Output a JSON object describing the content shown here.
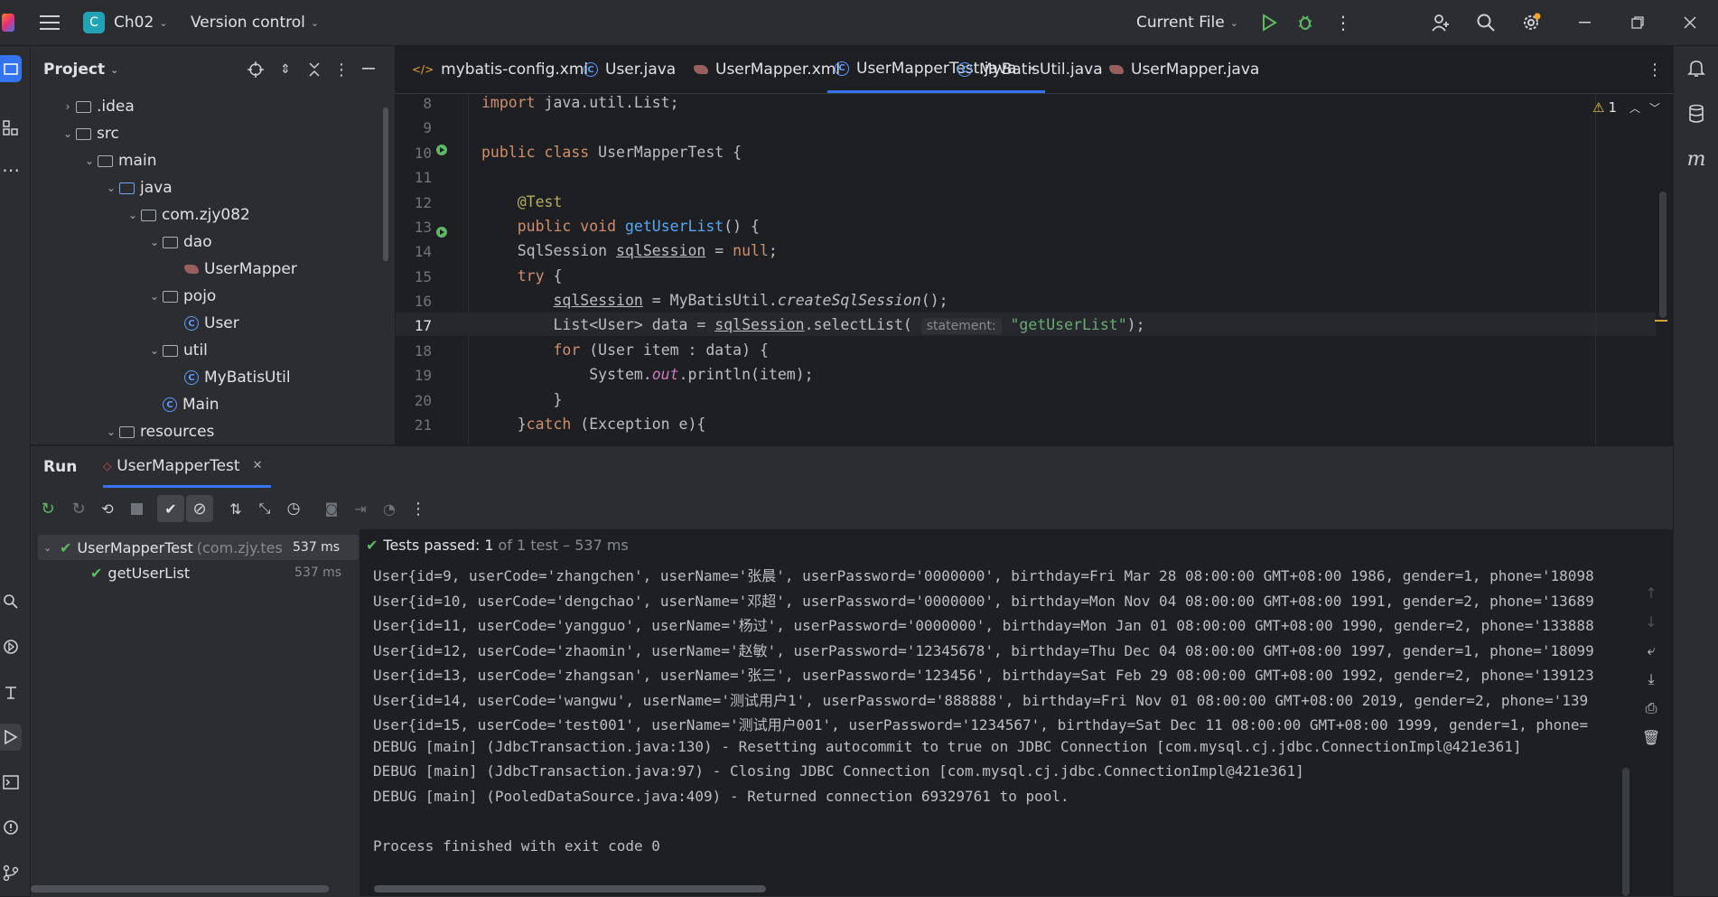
{
  "titlebar": {
    "project_badge": "C",
    "project_name": "Ch02",
    "version_control": "Version control",
    "run_config": "Current File"
  },
  "project_panel": {
    "title": "Project",
    "tree": [
      {
        "label": ".idea",
        "indent": 0,
        "toggle": "›",
        "kind": "folder"
      },
      {
        "label": "src",
        "indent": 0,
        "toggle": "⌄",
        "kind": "folder"
      },
      {
        "label": "main",
        "indent": 1,
        "toggle": "⌄",
        "kind": "folder"
      },
      {
        "label": "java",
        "indent": 2,
        "toggle": "⌄",
        "kind": "folder-blue"
      },
      {
        "label": "com.zjy082",
        "indent": 3,
        "toggle": "⌄",
        "kind": "package"
      },
      {
        "label": "dao",
        "indent": 4,
        "toggle": "⌄",
        "kind": "package"
      },
      {
        "label": "UserMapper",
        "indent": 5,
        "toggle": "",
        "kind": "mybatis"
      },
      {
        "label": "pojo",
        "indent": 4,
        "toggle": "⌄",
        "kind": "package"
      },
      {
        "label": "User",
        "indent": 5,
        "toggle": "",
        "kind": "class"
      },
      {
        "label": "util",
        "indent": 4,
        "toggle": "⌄",
        "kind": "package"
      },
      {
        "label": "MyBatisUtil",
        "indent": 5,
        "toggle": "",
        "kind": "class"
      },
      {
        "label": "Main",
        "indent": 4,
        "toggle": "",
        "kind": "class"
      },
      {
        "label": "resources",
        "indent": 2,
        "toggle": "⌄",
        "kind": "folder"
      }
    ]
  },
  "tabs": [
    {
      "label": "mybatis-config.xml",
      "icon": "xml-icon"
    },
    {
      "label": "User.java",
      "icon": "class-icon"
    },
    {
      "label": "UserMapper.xml",
      "icon": "mybatis-icon"
    },
    {
      "label": "UserMapperTest.java",
      "icon": "class-icon",
      "active": true
    },
    {
      "label": "MyBatisUtil.java",
      "icon": "class-icon"
    },
    {
      "label": "UserMapper.java",
      "icon": "mybatis-icon"
    }
  ],
  "editor": {
    "warning_count": "1",
    "line_numbers": [
      "8",
      "9",
      "10",
      "11",
      "12",
      "13",
      "14",
      "15",
      "16",
      "17",
      "18",
      "19",
      "20",
      "21"
    ],
    "param_hint": "statement:"
  },
  "run": {
    "title": "Run",
    "config_tab": "UserMapperTest",
    "status_prefix": "Tests passed:",
    "status_count": "1",
    "status_rest": "of 1 test – 537 ms",
    "tree_root": {
      "name": "UserMapperTest",
      "pkg": "(com.zjy.tes",
      "time": "537 ms"
    },
    "tree_child": {
      "name": "getUserList",
      "time": "537 ms"
    },
    "console": [
      "User{id=9, userCode='zhangchen', userName='张晨', userPassword='0000000', birthday=Fri Mar 28 08:00:00 GMT+08:00 1986, gender=1, phone='18098",
      "User{id=10, userCode='dengchao', userName='邓超', userPassword='0000000', birthday=Mon Nov 04 08:00:00 GMT+08:00 1991, gender=2, phone='13689",
      "User{id=11, userCode='yangguo', userName='杨过', userPassword='0000000', birthday=Mon Jan 01 08:00:00 GMT+08:00 1990, gender=2, phone='133888",
      "User{id=12, userCode='zhaomin', userName='赵敏', userPassword='12345678', birthday=Thu Dec 04 08:00:00 GMT+08:00 1997, gender=1, phone='18099",
      "User{id=13, userCode='zhangsan', userName='张三', userPassword='123456', birthday=Sat Feb 29 08:00:00 GMT+08:00 1992, gender=2, phone='139123",
      "User{id=14, userCode='wangwu', userName='测试用户1', userPassword='888888', birthday=Fri Nov 01 08:00:00 GMT+08:00 2019, gender=2, phone='139",
      "User{id=15, userCode='test001', userName='测试用户001', userPassword='1234567', birthday=Sat Dec 11 08:00:00 GMT+08:00 1999, gender=1, phone=",
      "DEBUG [main] (JdbcTransaction.java:130) - Resetting autocommit to true on JDBC Connection [com.mysql.cj.jdbc.ConnectionImpl@421e361]",
      "DEBUG [main] (JdbcTransaction.java:97) - Closing JDBC Connection [com.mysql.cj.jdbc.ConnectionImpl@421e361]",
      "DEBUG [main] (PooledDataSource.java:409) - Returned connection 69329761 to pool.",
      "",
      "Process finished with exit code 0"
    ]
  },
  "colors": {
    "accent": "#3574f0",
    "pass": "#5fb865",
    "badge": "#22a3b5"
  }
}
